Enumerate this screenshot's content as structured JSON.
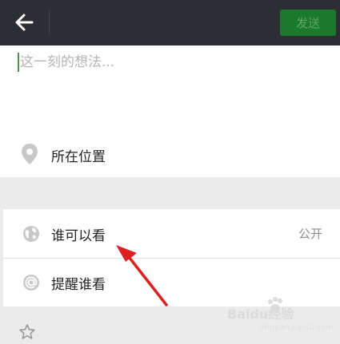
{
  "header": {
    "send_label": "发送"
  },
  "compose": {
    "placeholder": "这一刻的想法..."
  },
  "location": {
    "label": "所在位置"
  },
  "visibility": {
    "label": "谁可以看",
    "value": "公开"
  },
  "mention": {
    "label": "提醒谁看"
  },
  "watermark": {
    "text": "Baidu经验",
    "sub": "jingyan.baidu.com"
  },
  "icons": {
    "back": "arrow-left-icon",
    "location": "location-pin-icon",
    "visibility": "globe-icon",
    "mention": "at-sign-icon",
    "favorite": "star-icon"
  },
  "colors": {
    "topbar": "#2d2e33",
    "send_button": "#1a7a2c",
    "annotation_arrow": "#e02020"
  }
}
